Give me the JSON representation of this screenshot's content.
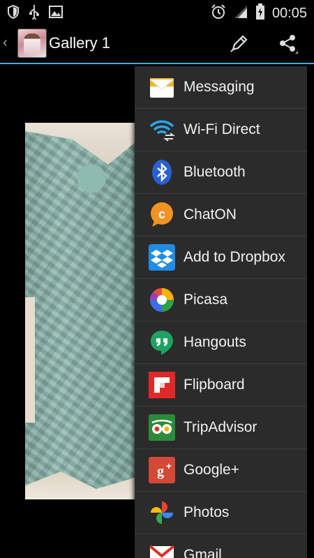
{
  "status_bar": {
    "time": "00:05",
    "left_icons": [
      "shield-icon",
      "usb-icon",
      "image-icon"
    ],
    "right_icons": [
      "alarm-icon",
      "signal-icon",
      "battery-charging-icon"
    ]
  },
  "action_bar": {
    "title": "Gallery 1",
    "up_icon": "chevron-left-icon",
    "actions": [
      "edit-pencil-icon",
      "share-icon"
    ]
  },
  "share_menu": {
    "items": [
      {
        "label": "Messaging",
        "icon": "messaging-icon"
      },
      {
        "label": "Wi-Fi Direct",
        "icon": "wifi-direct-icon"
      },
      {
        "label": "Bluetooth",
        "icon": "bluetooth-icon"
      },
      {
        "label": "ChatON",
        "icon": "chaton-icon"
      },
      {
        "label": "Add to Dropbox",
        "icon": "dropbox-icon"
      },
      {
        "label": "Picasa",
        "icon": "picasa-icon"
      },
      {
        "label": "Hangouts",
        "icon": "hangouts-icon"
      },
      {
        "label": "Flipboard",
        "icon": "flipboard-icon"
      },
      {
        "label": "TripAdvisor",
        "icon": "tripadvisor-icon"
      },
      {
        "label": "Google+",
        "icon": "google-plus-icon"
      },
      {
        "label": "Photos",
        "icon": "photos-icon"
      },
      {
        "label": "Gmail",
        "icon": "gmail-icon"
      }
    ]
  },
  "colors": {
    "accent": "#33b5e5",
    "menu_background": "#2b2b2b",
    "background": "#000000"
  }
}
